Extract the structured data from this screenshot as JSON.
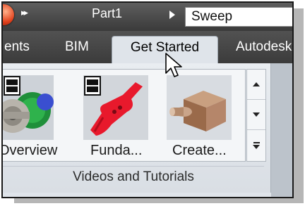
{
  "titlebar": {
    "document_title": "Part1",
    "search_text": "Sweep"
  },
  "tabs": [
    {
      "label": "ents"
    },
    {
      "label": "BIM"
    },
    {
      "label": "Get Started",
      "active": true
    },
    {
      "label": "Autodesk"
    }
  ],
  "panel": {
    "title": "Videos and Tutorials",
    "items": [
      {
        "label": "Overview",
        "icon": "gears-assembly-video-icon"
      },
      {
        "label": "Funda...",
        "icon": "guitar-video-icon"
      },
      {
        "label": "Create...",
        "icon": "block-part-icon"
      }
    ]
  },
  "colors": {
    "title_bar": "#4a4a4a",
    "ribbon_bg": "#dfe4ea",
    "orb": "#e2411c"
  }
}
